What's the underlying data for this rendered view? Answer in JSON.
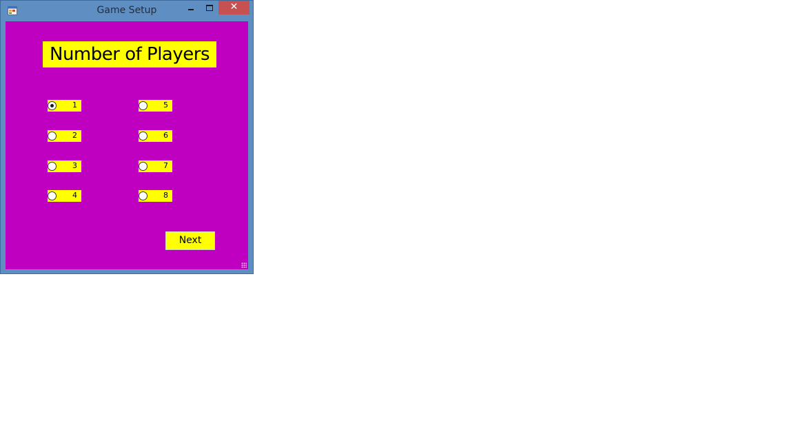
{
  "window": {
    "title": "Game Setup",
    "close_glyph": "✕"
  },
  "main": {
    "heading": "Number of Players",
    "options": [
      {
        "label": "1",
        "checked": true
      },
      {
        "label": "2",
        "checked": false
      },
      {
        "label": "3",
        "checked": false
      },
      {
        "label": "4",
        "checked": false
      },
      {
        "label": "5",
        "checked": false
      },
      {
        "label": "6",
        "checked": false
      },
      {
        "label": "7",
        "checked": false
      },
      {
        "label": "8",
        "checked": false
      }
    ],
    "next_label": "Next"
  },
  "colors": {
    "client_bg": "#c000c0",
    "control_bg": "#ffff00",
    "frame": "#5f8fc2",
    "close_bg": "#c75050"
  }
}
